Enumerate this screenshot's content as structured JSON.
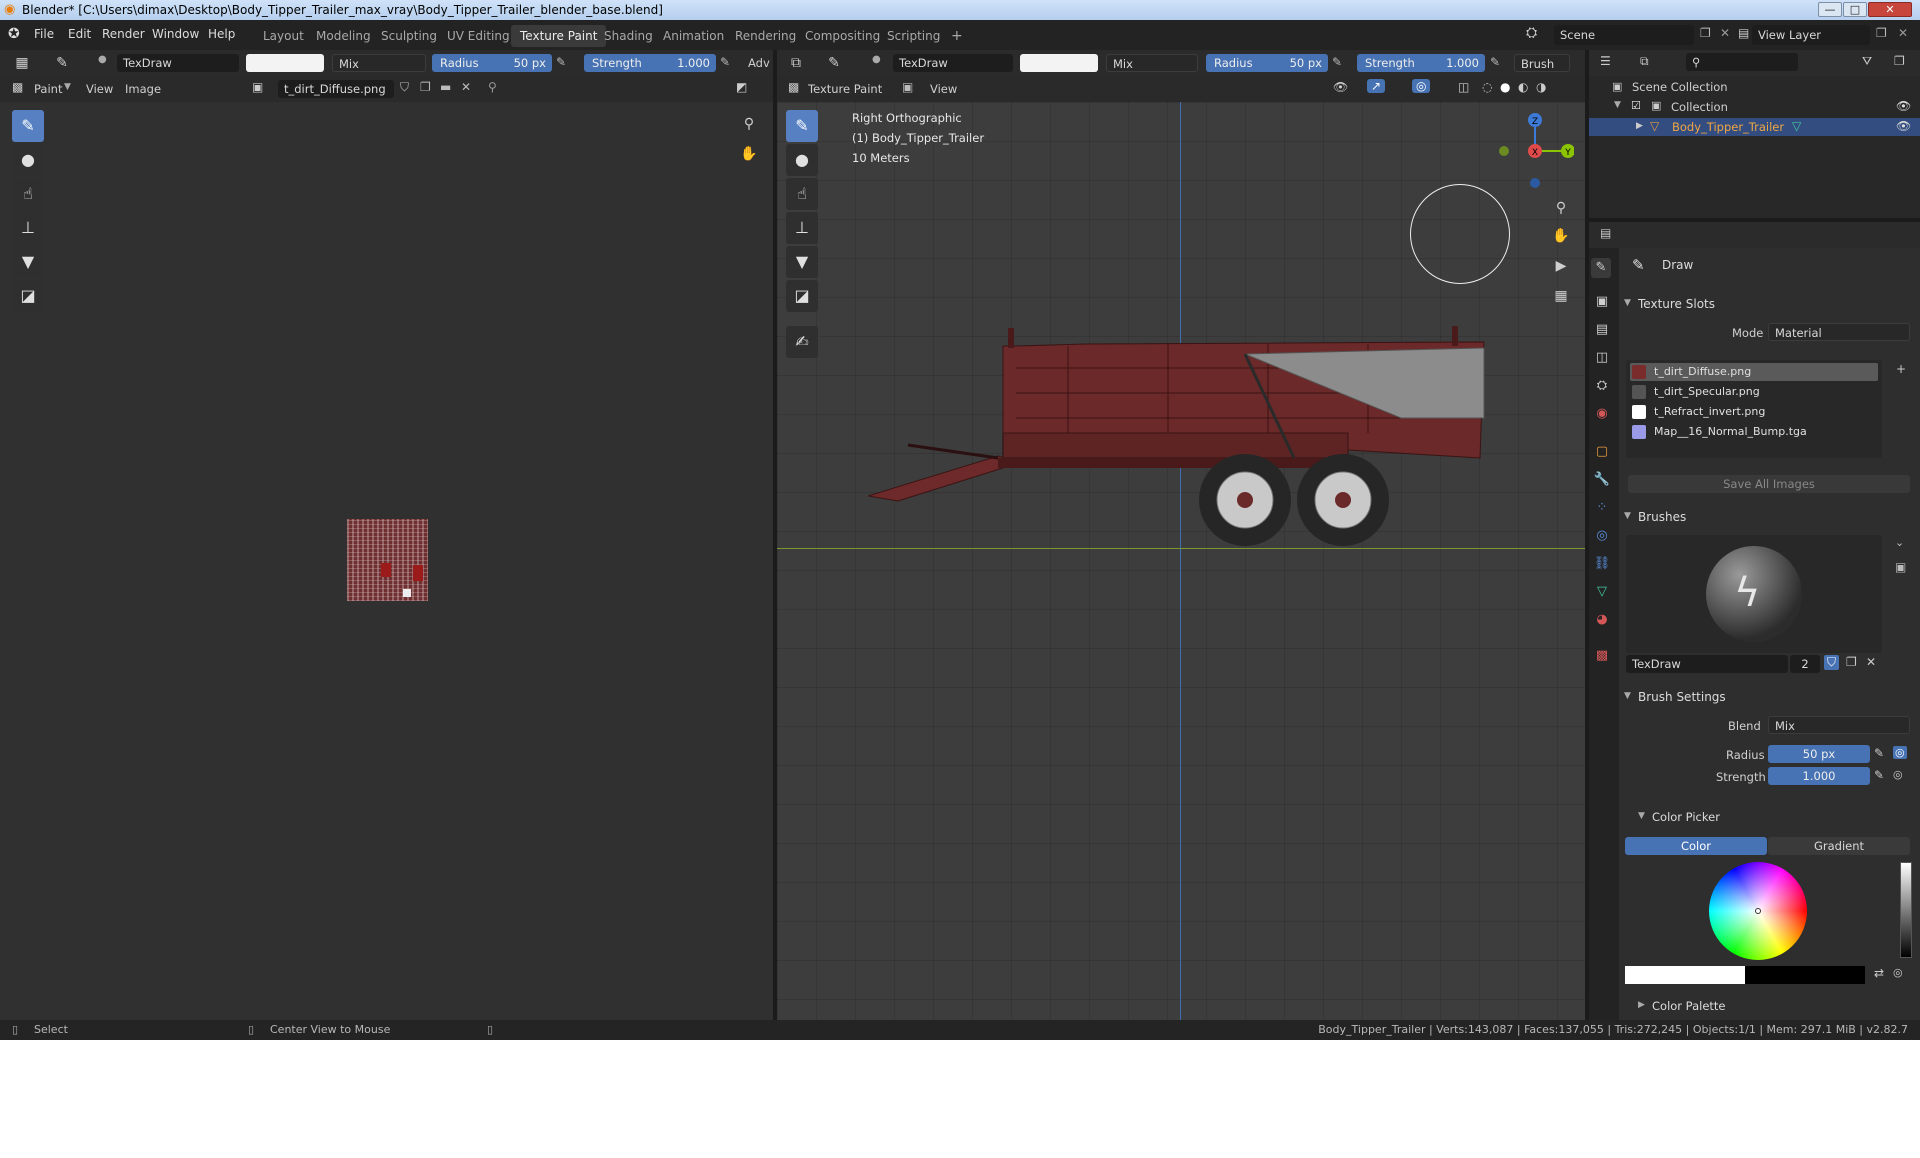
{
  "window": {
    "title": "Blender* [C:\\Users\\dimax\\Desktop\\Body_Tipper_Trailer_max_vray\\Body_Tipper_Trailer_blender_base.blend]",
    "minimize": "—",
    "maximize": "□",
    "close": "✕"
  },
  "menu": [
    "File",
    "Edit",
    "Render",
    "Window",
    "Help"
  ],
  "workspaces": [
    "Layout",
    "Modeling",
    "Sculpting",
    "UV Editing",
    "Texture Paint",
    "Shading",
    "Animation",
    "Rendering",
    "Compositing",
    "Scripting"
  ],
  "add_workspace": "+",
  "scene": {
    "label": "Scene",
    "view_layer": "View Layer"
  },
  "image_editor": {
    "tool_header": {
      "brush": "TexDraw",
      "blend": "Mix",
      "radius_label": "Radius",
      "radius_value": "50 px",
      "strength_label": "Strength",
      "strength_value": "1.000",
      "adv_label": "Adv"
    },
    "header": {
      "mode": "Paint",
      "view": "View",
      "image": "Image",
      "image_name": "t_dirt_Diffuse.png"
    }
  },
  "viewport": {
    "tool_header": {
      "brush": "TexDraw",
      "blend": "Mix",
      "radius_label": "Radius",
      "radius_value": "50 px",
      "strength_label": "Strength",
      "strength_value": "1.000",
      "brush_menu": "Brush"
    },
    "header": {
      "mode": "Texture Paint",
      "view": "View"
    },
    "overlay_text": [
      "Right Orthographic",
      "(1) Body_Tipper_Trailer",
      "10 Meters"
    ],
    "gizmo": {
      "z": "Z",
      "x": "X",
      "y": "Y"
    }
  },
  "outliner": {
    "scene_collection": "Scene Collection",
    "collection": "Collection",
    "object": "Body_Tipper_Trailer"
  },
  "properties": {
    "tool_name": "Draw",
    "texture_slots": {
      "title": "Texture Slots",
      "mode_label": "Mode",
      "mode_value": "Material",
      "slots": [
        {
          "name": "t_dirt_Diffuse.png",
          "color": "#7a2b2b",
          "selected": true
        },
        {
          "name": "t_dirt_Specular.png",
          "color": "#555555",
          "selected": false
        },
        {
          "name": "t_Refract_invert.png",
          "color": "#ffffff",
          "selected": false
        },
        {
          "name": "Map__16_Normal_Bump.tga",
          "color": "#9a9ae6",
          "selected": false
        }
      ],
      "save_all": "Save All Images"
    },
    "brushes": {
      "title": "Brushes",
      "brush_name": "TexDraw",
      "users": "2"
    },
    "brush_settings": {
      "title": "Brush Settings",
      "blend_label": "Blend",
      "blend_value": "Mix",
      "radius_label": "Radius",
      "radius_value": "50 px",
      "strength_label": "Strength",
      "strength_value": "1.000"
    },
    "color_picker": {
      "title": "Color Picker",
      "tab_color": "Color",
      "tab_gradient": "Gradient"
    },
    "color_palette": {
      "title": "Color Palette"
    }
  },
  "status": {
    "select": "Select",
    "center": "Center View to Mouse",
    "stats": "Body_Tipper_Trailer | Verts:143,087 | Faces:137,055 | Tris:272,245 | Objects:1/1 | Mem: 297.1 MiB | v2.82.7"
  },
  "colors": {
    "accent": "#4772b3",
    "selected_row": "#334d80",
    "bg": "#303030"
  }
}
